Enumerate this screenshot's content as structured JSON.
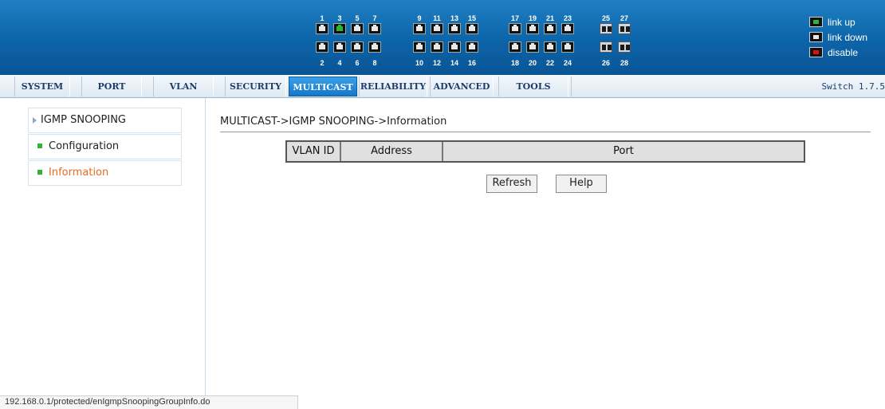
{
  "header": {
    "port_groups": [
      {
        "top": [
          "1",
          "3",
          "5",
          "7"
        ],
        "bottom": [
          "2",
          "4",
          "6",
          "8"
        ],
        "top_states": [
          "down",
          "up",
          "down",
          "down"
        ],
        "bottom_states": [
          "down",
          "down",
          "down",
          "down"
        ]
      },
      {
        "top": [
          "9",
          "11",
          "13",
          "15"
        ],
        "bottom": [
          "10",
          "12",
          "14",
          "16"
        ],
        "top_states": [
          "down",
          "down",
          "down",
          "down"
        ],
        "bottom_states": [
          "down",
          "down",
          "down",
          "down"
        ]
      },
      {
        "top": [
          "17",
          "19",
          "21",
          "23"
        ],
        "bottom": [
          "18",
          "20",
          "22",
          "24"
        ],
        "top_states": [
          "down",
          "down",
          "down",
          "down"
        ],
        "bottom_states": [
          "down",
          "down",
          "down",
          "down"
        ]
      },
      {
        "top": [
          "25",
          "27"
        ],
        "bottom": [
          "26",
          "28"
        ],
        "top_states": [
          "sfp",
          "sfp"
        ],
        "bottom_states": [
          "sfp",
          "sfp"
        ]
      }
    ],
    "legend": {
      "link_up": "link up",
      "link_down": "link down",
      "disable": "disable"
    },
    "colors": {
      "link_up": "#2fb52f",
      "link_down": "#e8e8e8",
      "disable": "#e01010",
      "header_bg": "#0c64a8"
    }
  },
  "nav": {
    "items": [
      "SYSTEM",
      "PORT",
      "VLAN",
      "SECURITY",
      "MULTICAST",
      "RELIABILITY",
      "ADVANCED",
      "TOOLS"
    ],
    "active": "MULTICAST",
    "version": "Switch 1.7.5"
  },
  "sidebar": {
    "group_label": "IGMP SNOOPING",
    "items": [
      {
        "label": "Configuration"
      },
      {
        "label": "Information"
      }
    ],
    "current": "Information"
  },
  "main": {
    "breadcrumb": "MULTICAST->IGMP SNOOPING->Information",
    "table_headers": [
      "VLAN ID",
      "Address",
      "Port"
    ],
    "buttons": {
      "refresh": "Refresh",
      "help": "Help"
    }
  },
  "status_bar": {
    "url": "192.168.0.1/protected/enIgmpSnoopingGroupInfo.do"
  }
}
